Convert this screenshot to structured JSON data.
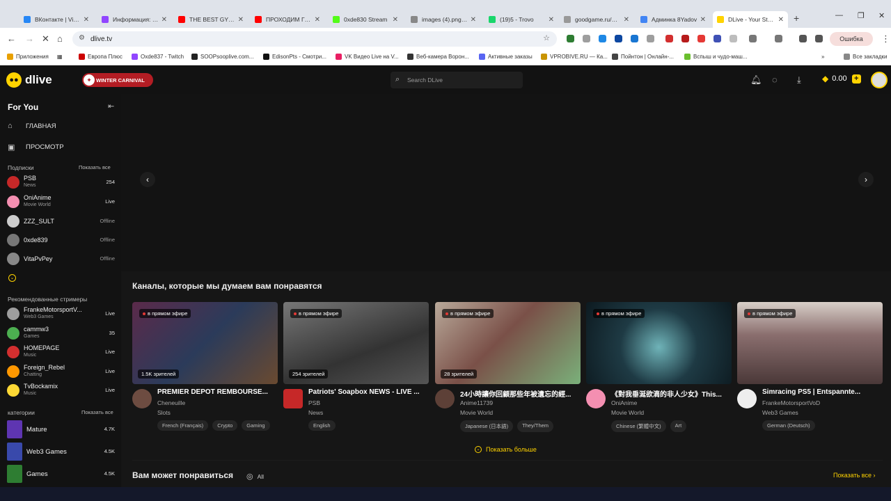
{
  "browser": {
    "tabs": [
      {
        "label": "ВКонтакте | Video",
        "color": "#2787f5"
      },
      {
        "label": "Информация: O...",
        "color": "#9146ff"
      },
      {
        "label": "THE BEST GYM...",
        "color": "#ff0000"
      },
      {
        "label": "ПРОХОДИМ ГТА",
        "color": "#ff0000"
      },
      {
        "label": "0xde830 Stream",
        "color": "#53fc18"
      },
      {
        "label": "images (4).png (2...",
        "color": "#888888"
      },
      {
        "label": "(19)5 - Trovo",
        "color": "#19d66b"
      },
      {
        "label": "goodgame.ru/0x...",
        "color": "#999999"
      },
      {
        "label": "Админка 8Yadov",
        "color": "#4285f4"
      },
      {
        "label": "DLive - Your Strea...",
        "color": "#ffd300"
      }
    ],
    "url": "dlive.tv",
    "error_label": "Ошибка",
    "bookmarks": [
      {
        "label": "Приложения",
        "color": "#e8a000"
      },
      {
        "label": "Европа Плюс",
        "color": "#cc0000"
      },
      {
        "label": "Oxde837 - Twitch",
        "color": "#9146ff"
      },
      {
        "label": "SOOPsooplive.com...",
        "color": "#222222"
      },
      {
        "label": "EdisonPts - Смотри...",
        "color": "#111111"
      },
      {
        "label": "VK Видео Live на V...",
        "color": "#e91e63"
      },
      {
        "label": "Веб-камера Ворон...",
        "color": "#333333"
      },
      {
        "label": "Активные заказы",
        "color": "#5865f2"
      },
      {
        "label": "VPROBIVE.RU — Ка...",
        "color": "#c99400"
      },
      {
        "label": "Пойнтон | Онлайн-...",
        "color": "#444444"
      },
      {
        "label": "Вспыш и чудо-маш...",
        "color": "#6abf2e"
      }
    ],
    "all_bookmarks": "Все закладки"
  },
  "header": {
    "logo": "dlive",
    "carnival": "WINTER CARNIVAL",
    "search_placeholder": "Search DLive",
    "balance": "0.00"
  },
  "sidebar": {
    "title": "For You",
    "nav": [
      {
        "label": "ГЛАВНАЯ"
      },
      {
        "label": "ПРОСМОТР"
      }
    ],
    "subs_title": "Подписки",
    "subs_more": "Показать все",
    "subs": [
      {
        "name": "PSB",
        "sub": "News",
        "status": "254",
        "color": "#c62828"
      },
      {
        "name": "OniAnime",
        "sub": "Movie World",
        "status": "Live",
        "color": "#f48fb1"
      },
      {
        "name": "ZZZ_SULT",
        "sub": "",
        "status": "Offline",
        "color": "#cccccc"
      },
      {
        "name": "0xde839",
        "sub": "",
        "status": "Offline",
        "color": "#777777"
      },
      {
        "name": "VitaPvPey",
        "sub": "",
        "status": "Offline",
        "color": "#888888"
      }
    ],
    "rec_title": "Рекомендованные стримеры",
    "rec": [
      {
        "name": "FrankeMotorsportV...",
        "sub": "Web3 Games",
        "status": "Live",
        "color": "#9e9e9e"
      },
      {
        "name": "cammw3",
        "sub": "Games",
        "status": "35",
        "color": "#4caf50"
      },
      {
        "name": "HOMEPAGE",
        "sub": "Music",
        "status": "Live",
        "color": "#d32f2f"
      },
      {
        "name": "Foreign_Rebel",
        "sub": "Chatting",
        "status": "Live",
        "color": "#ff9800"
      },
      {
        "name": "TvBockamix",
        "sub": "Music",
        "status": "Live",
        "color": "#fdd835"
      }
    ],
    "cat_title": "категории",
    "cat_more": "Показать все",
    "categories": [
      {
        "name": "Mature",
        "viewers": "4.7K",
        "color": "#5e35b1"
      },
      {
        "name": "Web3 Games",
        "viewers": "4.5K",
        "color": "#3949ab"
      },
      {
        "name": "Games",
        "viewers": "4.5K",
        "color": "#2e7d32"
      }
    ]
  },
  "main": {
    "section_title": "Каналы, которые мы думаем вам понравятся",
    "live_label": "в прямом эфире",
    "cards": [
      {
        "title": "PREMIER DEPOT REMBOURSE...",
        "channel": "Cheneuille",
        "category": "Slots",
        "viewers": "1.5K зрителей",
        "tags": [
          "French (Français)",
          "Crypto",
          "Gaming"
        ],
        "thumb": "#3a2a3c",
        "avatar": "#6d4c41"
      },
      {
        "title": "Patriots' Soapbox NEWS - LIVE ...",
        "channel": "PSB",
        "category": "News",
        "viewers": "254 зрителей",
        "tags": [
          "English"
        ],
        "thumb": "#4a4a4a",
        "avatar": "#c62828"
      },
      {
        "title": "24小時讓你回顧那些年被遺忘的經...",
        "channel": "Anime11739",
        "category": "Movie World",
        "viewers": "28 зрителей",
        "tags": [
          "Japanese (日本語)",
          "They/Them"
        ],
        "thumb": "#7a6a62",
        "avatar": "#5d4037"
      },
      {
        "title": "《對我垂涎欲滴的非人少女》This...",
        "channel": "OniAnime",
        "category": "Movie World",
        "viewers": "",
        "tags": [
          "Chinese (繁體中文)",
          "Art"
        ],
        "thumb": "#1e3a44",
        "avatar": "#f48fb1"
      },
      {
        "title": "Simracing PS5 | Entspannte...",
        "channel": "FrankeMotorsportVoD",
        "category": "Web3 Games",
        "viewers": "",
        "tags": [
          "German (Deutsch)"
        ],
        "thumb": "#6b5656",
        "avatar": "#eeeeee"
      }
    ],
    "show_more": "Показать больше",
    "section2_title": "Вам может понравиться",
    "all_label": "All",
    "show_all": "Показать все"
  }
}
